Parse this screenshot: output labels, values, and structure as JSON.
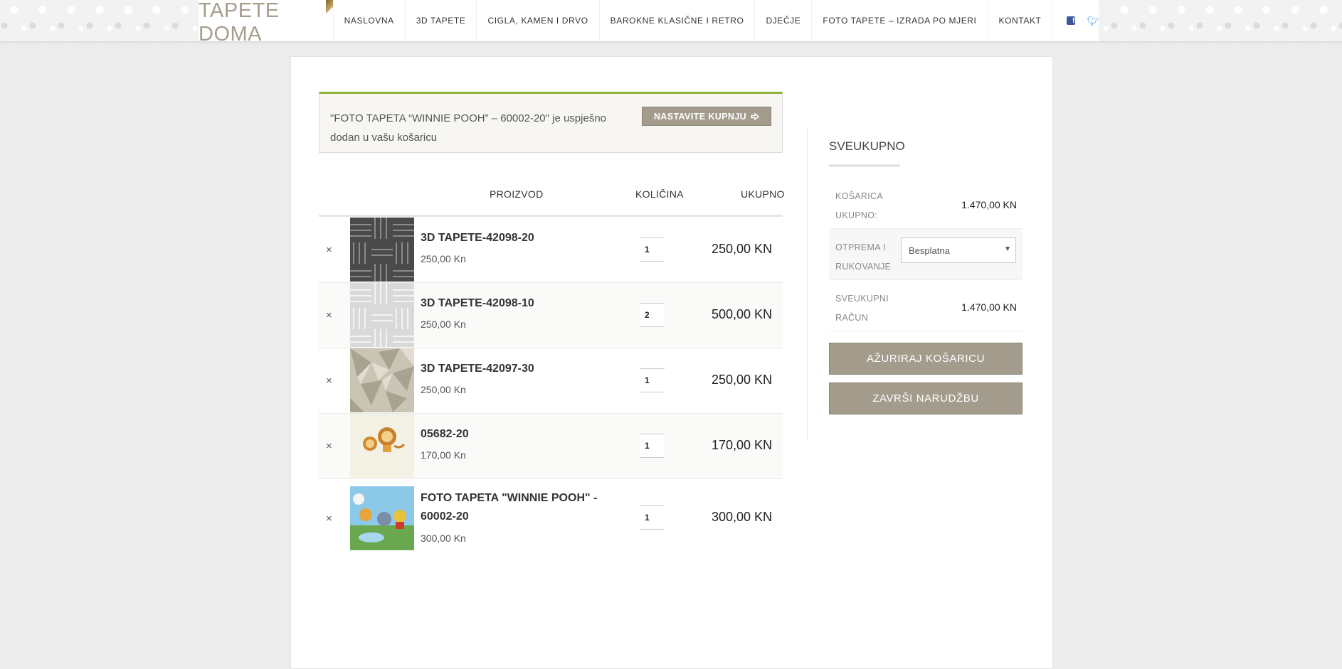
{
  "header": {
    "logo": "TAPETE DOMA",
    "nav": [
      "NASLOVNA",
      "3D TAPETE",
      "CIGLA, KAMEN I DRVO",
      "BAROKNE KLASIČNE I RETRO",
      "DJEČJE",
      "FOTO TAPETE – IZRADA PO MJERI",
      "KONTAKT"
    ],
    "social": {
      "facebook": "facebook-icon",
      "twitter": "twitter-icon"
    }
  },
  "notice": {
    "text": "\"FOTO TAPETA “WINNIE POOH” – 60002-20\" je uspješno dodan u vašu košaricu",
    "button": "NASTAVITE KUPNJU",
    "accent": "#8fb137"
  },
  "table": {
    "headers": {
      "product": "PROIZVOD",
      "quantity": "KOLIČINA",
      "total": "UKUPNO"
    },
    "rows": [
      {
        "name": "3D TAPETE-42098-20",
        "price": "250,00 Kn",
        "qty": "1",
        "total": "250,00 KN"
      },
      {
        "name": "3D TAPETE-42098-10",
        "price": "250,00 Kn",
        "qty": "2",
        "total": "500,00 KN"
      },
      {
        "name": "3D TAPETE-42097-30",
        "price": "250,00 Kn",
        "qty": "1",
        "total": "250,00 KN"
      },
      {
        "name": "05682-20",
        "price": "170,00 Kn",
        "qty": "1",
        "total": "170,00 KN"
      },
      {
        "name_line1": "FOTO TAPETA \"WINNIE POOH\" -",
        "name_line2": "60002-20",
        "price": "300,00 Kn",
        "qty": "1",
        "total": "300,00 KN"
      }
    ],
    "remove_symbol": "×"
  },
  "summary": {
    "title": "SVEUKUPNO",
    "cart_label_1": "KOŠARICA",
    "cart_label_2": "UKUPNO:",
    "cart_value": "1.470,00 KN",
    "shipping_label_1": "OTPREMA I",
    "shipping_label_2": "RUKOVANJE",
    "shipping_value": "Besplatna",
    "total_label_1": "SVEUKUPNI",
    "total_label_2": "RAČUN",
    "total_value": "1.470,00 KN",
    "update_button": "AŽURIRAJ KOŠARICU",
    "checkout_button": "ZAVRŠI NARUDŽBU"
  },
  "colors": {
    "button": "#a39c8d",
    "logo": "#a69d8c",
    "facebook": "#3b5998",
    "twitter": "#3aa7e5"
  }
}
